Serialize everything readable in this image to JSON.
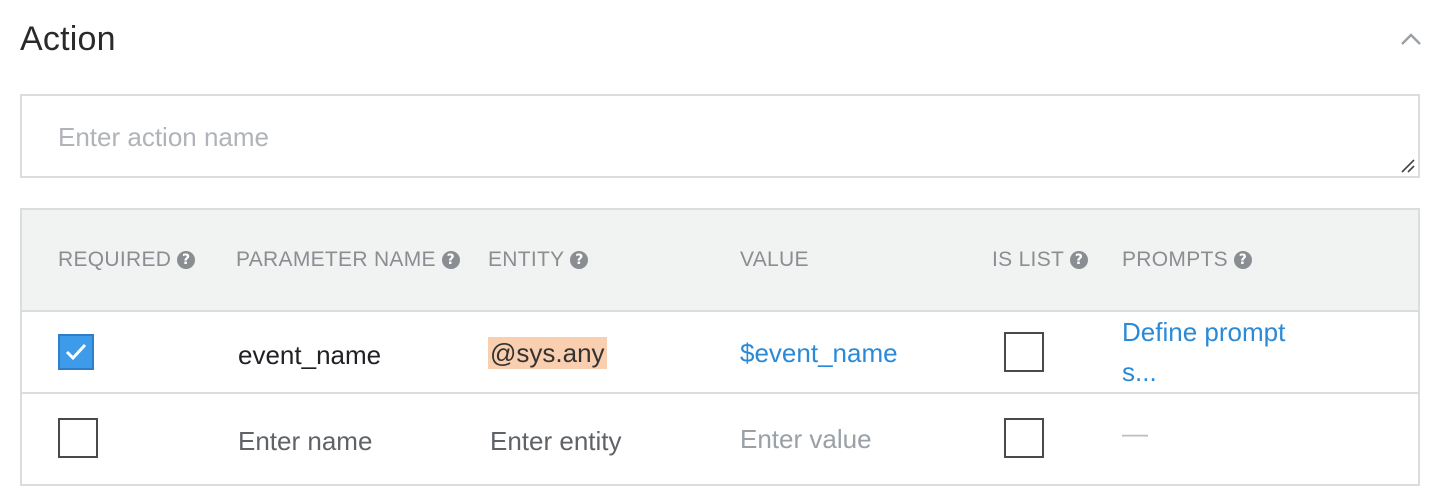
{
  "section": {
    "title": "Action",
    "collapse_icon": "chevron-up-icon"
  },
  "action_name": {
    "value": "",
    "placeholder": "Enter action name"
  },
  "parameters": {
    "columns": {
      "required": "REQUIRED",
      "parameter_name": "PARAMETER NAME",
      "entity": "ENTITY",
      "value": "VALUE",
      "is_list": "IS LIST",
      "prompts": "PROMPTS"
    },
    "help_icon": "question-circle-icon",
    "rows": [
      {
        "required": true,
        "name": "event_name",
        "entity": "@sys.any",
        "value": "$event_name",
        "is_list": false,
        "prompts": "Define prompts..."
      },
      {
        "required": false,
        "name_placeholder": "Enter name",
        "entity_placeholder": "Enter entity",
        "value_placeholder": "Enter value",
        "is_list": false,
        "prompts": "—"
      }
    ]
  },
  "colors": {
    "accent": "#2a8ad8",
    "checkbox_checked": "#3d9be9",
    "entity_highlight": "#f9cfb0",
    "header_bg": "#f1f3f2",
    "border": "#dadce0"
  }
}
